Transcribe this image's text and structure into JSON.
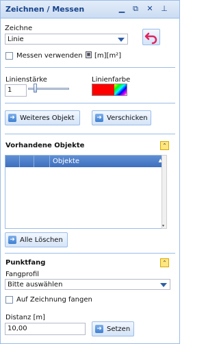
{
  "window": {
    "title": "Zeichnen / Messen"
  },
  "draw": {
    "zeichne_label": "Zeichne",
    "zeichne_value": "Linie",
    "measure_label": "Messen verwenden",
    "measure_unit": "[m][m²]"
  },
  "line": {
    "width_label": "Linienstärke",
    "width_value": "1",
    "color_label": "Linienfarbe",
    "color_value": "#ff0000"
  },
  "actions": {
    "weiteres": "Weiteres Objekt",
    "verschicken": "Verschicken"
  },
  "objects": {
    "title": "Vorhandene Objekte",
    "column_header": "Objekte",
    "clear_all": "Alle Löschen"
  },
  "snap": {
    "title": "Punktfang",
    "profile_label": "Fangprofil",
    "profile_value": "Bitte auswählen",
    "snap_drawing_label": "Auf Zeichnung fangen",
    "distance_label": "Distanz [m]",
    "distance_value": "10,00",
    "set_button": "Setzen"
  },
  "colors": {
    "accent": "#15428b",
    "border": "#99bbe8"
  }
}
